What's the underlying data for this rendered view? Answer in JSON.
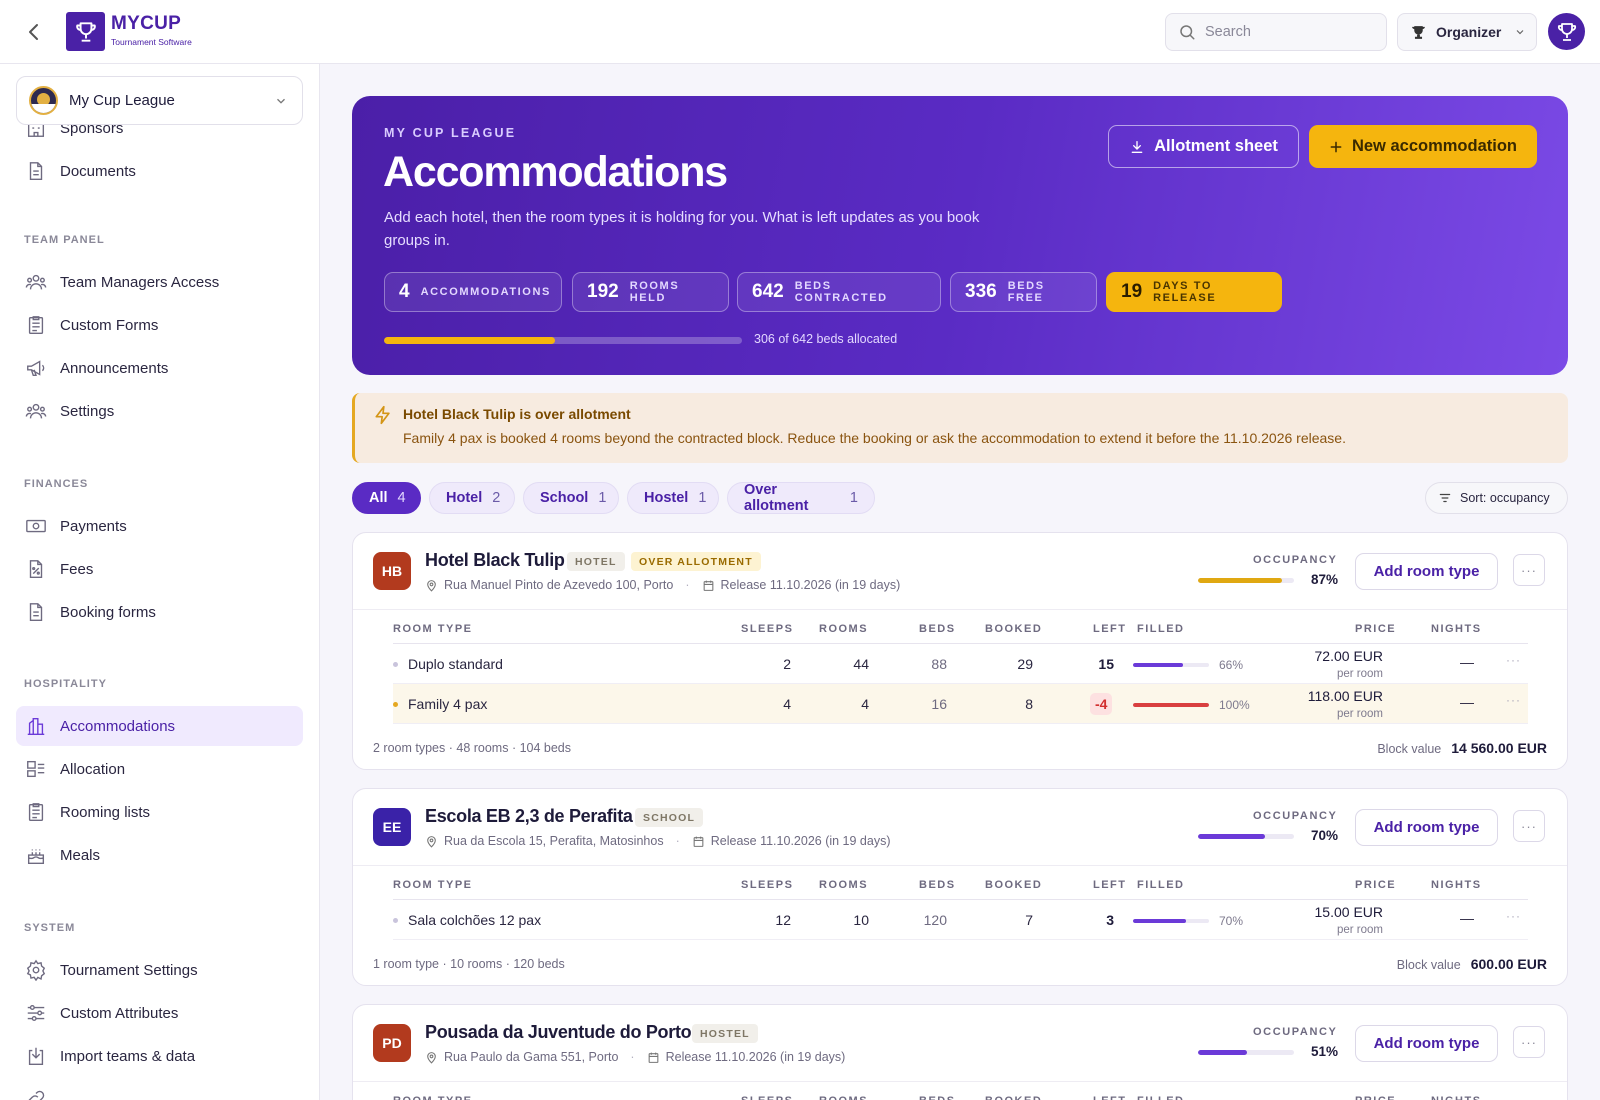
{
  "header": {
    "logo_name": "MYCUP",
    "logo_sub": "Tournament Software",
    "search_placeholder": "Search",
    "role_label": "Organizer"
  },
  "sidebar": {
    "org_name": "My Cup League",
    "top_items": [
      {
        "label": "Sponsors",
        "icon": "building-icon"
      },
      {
        "label": "Documents",
        "icon": "document-icon"
      }
    ],
    "sections": [
      {
        "title": "TEAM PANEL",
        "items": [
          {
            "label": "Team Managers Access",
            "icon": "users-icon"
          },
          {
            "label": "Custom Forms",
            "icon": "clipboard-icon"
          },
          {
            "label": "Announcements",
            "icon": "megaphone-icon"
          },
          {
            "label": "Settings",
            "icon": "users-gear-icon"
          }
        ]
      },
      {
        "title": "FINANCES",
        "items": [
          {
            "label": "Payments",
            "icon": "money-icon"
          },
          {
            "label": "Fees",
            "icon": "percent-doc-icon"
          },
          {
            "label": "Booking forms",
            "icon": "document-icon"
          }
        ]
      },
      {
        "title": "HOSPITALITY",
        "items": [
          {
            "label": "Accommodations",
            "icon": "hotel-chart-icon",
            "active": true
          },
          {
            "label": "Allocation",
            "icon": "allocation-icon"
          },
          {
            "label": "Rooming lists",
            "icon": "clipboard-icon"
          },
          {
            "label": "Meals",
            "icon": "cake-icon"
          }
        ]
      },
      {
        "title": "SYSTEM",
        "items": [
          {
            "label": "Tournament Settings",
            "icon": "gear-icon"
          },
          {
            "label": "Custom Attributes",
            "icon": "sliders-icon"
          },
          {
            "label": "Import teams & data",
            "icon": "import-icon"
          }
        ]
      }
    ]
  },
  "hero": {
    "eyebrow": "MY CUP LEAGUE",
    "title": "Accommodations",
    "description": "Add each hotel, then the room types it is holding for you. What is left updates as you book groups in.",
    "btn_allotment": "Allotment sheet",
    "btn_new": "New accommodation",
    "stats": [
      {
        "num": "4",
        "label": "ACCOMMODATIONS"
      },
      {
        "num": "192",
        "label": "ROOMS HELD"
      },
      {
        "num": "642",
        "label": "BEDS CONTRACTED"
      },
      {
        "num": "336",
        "label": "BEDS FREE"
      },
      {
        "num": "19",
        "label": "DAYS TO RELEASE",
        "highlight": true
      }
    ],
    "progress_fraction": 0.4766,
    "progress_text": "306 of 642 beds allocated"
  },
  "alert": {
    "title": "Hotel Black Tulip is over allotment",
    "text": "Family 4 pax is booked 4 rooms beyond the contracted block. Reduce the booking or ask the accommodation to extend it before the 11.10.2026 release."
  },
  "filters": [
    {
      "label": "All",
      "count": "4",
      "active": true
    },
    {
      "label": "Hotel",
      "count": "2"
    },
    {
      "label": "School",
      "count": "1"
    },
    {
      "label": "Hostel",
      "count": "1"
    },
    {
      "label": "Over allotment",
      "count": "1"
    }
  ],
  "sort_label": "Sort: occupancy",
  "table_headers": {
    "room_type": "ROOM TYPE",
    "sleeps": "SLEEPS",
    "rooms": "ROOMS",
    "beds": "BEDS",
    "booked": "BOOKED",
    "left": "LEFT",
    "filled": "FILLED",
    "price": "PRICE",
    "nights": "NIGHTS"
  },
  "labels": {
    "occupancy": "OCCUPANCY",
    "add_room_type": "Add room type",
    "block_value": "Block value"
  },
  "colors": {
    "brand": "#4a21a6",
    "accent_yellow": "#f5b50e",
    "danger": "#d22f2f"
  },
  "accommodations": [
    {
      "initials": "HB",
      "badge_color": "#b23a1e",
      "name": "Hotel Black Tulip",
      "type_tag": "HOTEL",
      "warn_tag": "OVER ALLOTMENT",
      "address": "Rua Manuel Pinto de Azevedo 100, Porto",
      "release": "Release 11.10.2026 (in 19 days)",
      "occupancy_pct": "87%",
      "occupancy_fraction": 0.87,
      "occupancy_color": "#e0a812",
      "rooms": [
        {
          "name": "Duplo standard",
          "sleeps": "2",
          "rooms": "44",
          "beds": "88",
          "booked": "29",
          "left": "15",
          "filled_pct": "66%",
          "filled_fraction": 0.66,
          "filled_color": "#6b3ad8",
          "price": "72.00 EUR",
          "price_unit": "per room",
          "nights": "—"
        },
        {
          "name": "Family 4 pax",
          "sleeps": "4",
          "rooms": "4",
          "beds": "16",
          "booked": "8",
          "left": "-4",
          "filled_pct": "100%",
          "filled_fraction": 1.0,
          "filled_color": "#d94040",
          "price": "118.00 EUR",
          "price_unit": "per room",
          "nights": "—",
          "warn": true
        }
      ],
      "summary": "2 room types · 48 rooms · 104 beds",
      "block_value": "14 560.00 EUR"
    },
    {
      "initials": "EE",
      "badge_color": "#3a22a8",
      "name": "Escola EB 2,3 de Perafita",
      "type_tag": "SCHOOL",
      "address": "Rua da Escola 15, Perafita, Matosinhos",
      "release": "Release 11.10.2026 (in 19 days)",
      "occupancy_pct": "70%",
      "occupancy_fraction": 0.7,
      "occupancy_color": "#6b3ad8",
      "rooms": [
        {
          "name": "Sala colchões 12 pax",
          "sleeps": "12",
          "rooms": "10",
          "beds": "120",
          "booked": "7",
          "left": "3",
          "filled_pct": "70%",
          "filled_fraction": 0.7,
          "filled_color": "#6b3ad8",
          "price": "15.00 EUR",
          "price_unit": "per room",
          "nights": "—"
        }
      ],
      "summary": "1 room type · 10 rooms · 120 beds",
      "block_value": "600.00 EUR"
    },
    {
      "initials": "PD",
      "badge_color": "#b23a1e",
      "name": "Pousada da Juventude do Porto",
      "type_tag": "HOSTEL",
      "address": "Rua Paulo da Gama 551, Porto",
      "release": "Release 11.10.2026 (in 19 days)",
      "occupancy_pct": "51%",
      "occupancy_fraction": 0.51,
      "occupancy_color": "#6b3ad8"
    }
  ]
}
